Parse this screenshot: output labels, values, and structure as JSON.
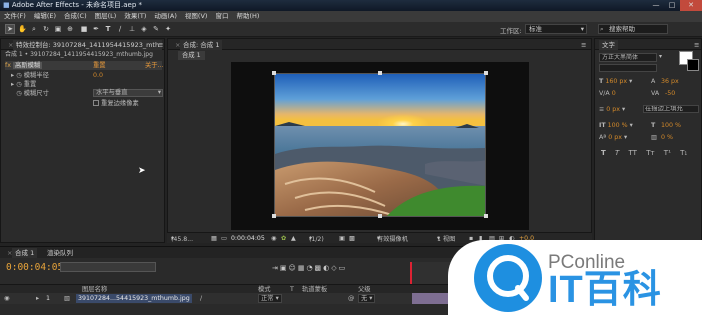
{
  "titlebar": {
    "title": "Adobe After Effects - 未命名项目.aep *"
  },
  "window_controls": {
    "minimize": "—",
    "maximize": "□",
    "close": "✕"
  },
  "menu": [
    "文件(F)",
    "编辑(E)",
    "合成(C)",
    "图层(L)",
    "效果(T)",
    "动画(A)",
    "视图(V)",
    "窗口",
    "帮助(H)"
  ],
  "toolbar": {
    "workspace_label": "工作区:",
    "workspace_value": "标准",
    "search_placeholder": "搜索帮助"
  },
  "effects_panel": {
    "tab_label": "特效控制台: 39107284_1411954415923_mth",
    "subtitle": "合成 1 • 39107284_1411954415923_mthumb.jpg",
    "effect_name": "高斯模糊",
    "reset": "重置",
    "about": "关于...",
    "props": [
      {
        "label": "模糊半径",
        "value": "0.0"
      },
      {
        "label": "重置",
        "value": ""
      },
      {
        "label": "模糊尺寸",
        "value": "水平与垂直"
      }
    ],
    "checkbox_label": "重复边缘像素"
  },
  "comp_panel": {
    "tab_label": "合成: 合成 1",
    "comp_button": "合成 1",
    "controls": {
      "zoom": "(45.8...",
      "timecode": "0:00:04:05",
      "resolution": "(1/2)",
      "camera": "有效摄像机",
      "views": "1 视图",
      "offset": "+0.0"
    }
  },
  "char_panel": {
    "tab_label": "文字",
    "font": "方正大黑简体",
    "size": "160 px",
    "leading": "36 px",
    "tracking": "0",
    "kerning": "-50",
    "stroke": "0 px",
    "stroke_mode": "在描边上填充",
    "vscale": "100 %",
    "hscale": "100 %",
    "baseline": "0 px",
    "tsume": "0 %",
    "styles": [
      "T",
      "T",
      "TT",
      "Tт",
      "T¹",
      "T₁"
    ]
  },
  "timeline": {
    "tabs": [
      "合成 1",
      "渲染队列"
    ],
    "timecode": "0:00:04:05",
    "columns": [
      "图层名称",
      "模式",
      "T",
      "轨道蒙板",
      "父级"
    ],
    "layer": {
      "index": "1",
      "name": "39107284...54415923_mthumb.jpg",
      "mode": "正常",
      "parent": "无"
    }
  },
  "watermark": {
    "line1": "PConline",
    "line2": "IT百科"
  }
}
